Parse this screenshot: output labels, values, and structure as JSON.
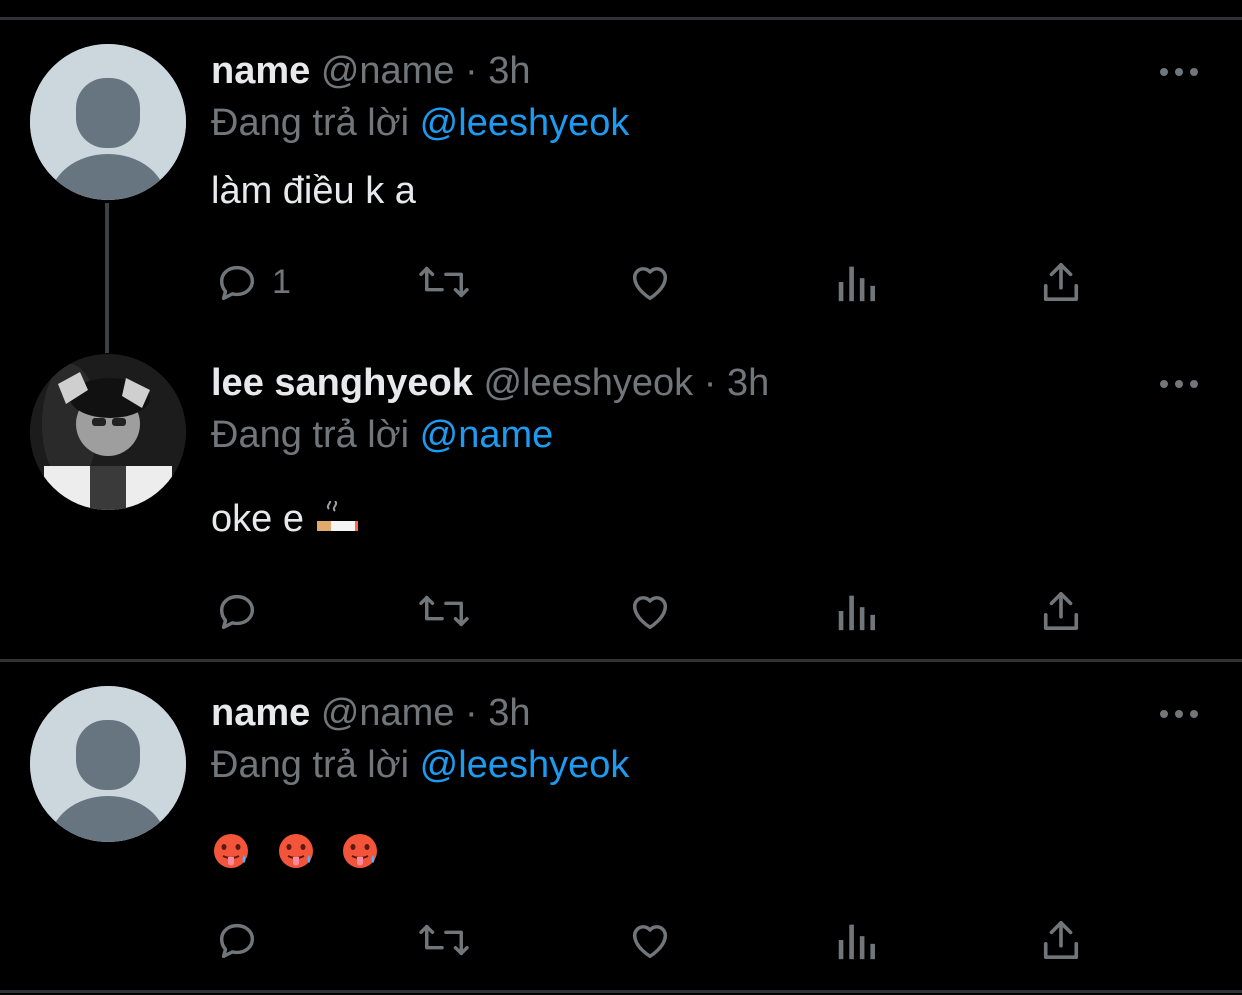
{
  "tweets": [
    {
      "display_name": "name",
      "handle": "@name",
      "separator": "·",
      "time": "3h",
      "reply_prefix": "Đang trả lời",
      "reply_to": "@leeshyeok",
      "text": "làm điều k a",
      "reply_count": "1",
      "avatar": "default-avatar-icon"
    },
    {
      "display_name": "lee sanghyeok",
      "handle": "@leeshyeok",
      "separator": "·",
      "time": "3h",
      "reply_prefix": "Đang trả lời",
      "reply_to": "@name",
      "text": "oke e",
      "emoji": "cigarette-emoji",
      "reply_count": "",
      "avatar": "profile-photo"
    },
    {
      "display_name": "name",
      "handle": "@name",
      "separator": "·",
      "time": "3h",
      "reply_prefix": "Đang trả lời",
      "reply_to": "@leeshyeok",
      "text": "",
      "emoji": "hot-face-emoji ×3",
      "reply_count": "",
      "avatar": "default-avatar-icon"
    }
  ],
  "icons": {
    "reply": "reply-icon",
    "retweet": "retweet-icon",
    "like": "like-icon",
    "views": "views-icon",
    "share": "share-icon",
    "more": "more-icon"
  },
  "colors": {
    "background": "#000000",
    "text": "#e7e9ea",
    "muted": "#71767b",
    "mention": "#1d9bf0",
    "divider": "#2f3336"
  }
}
